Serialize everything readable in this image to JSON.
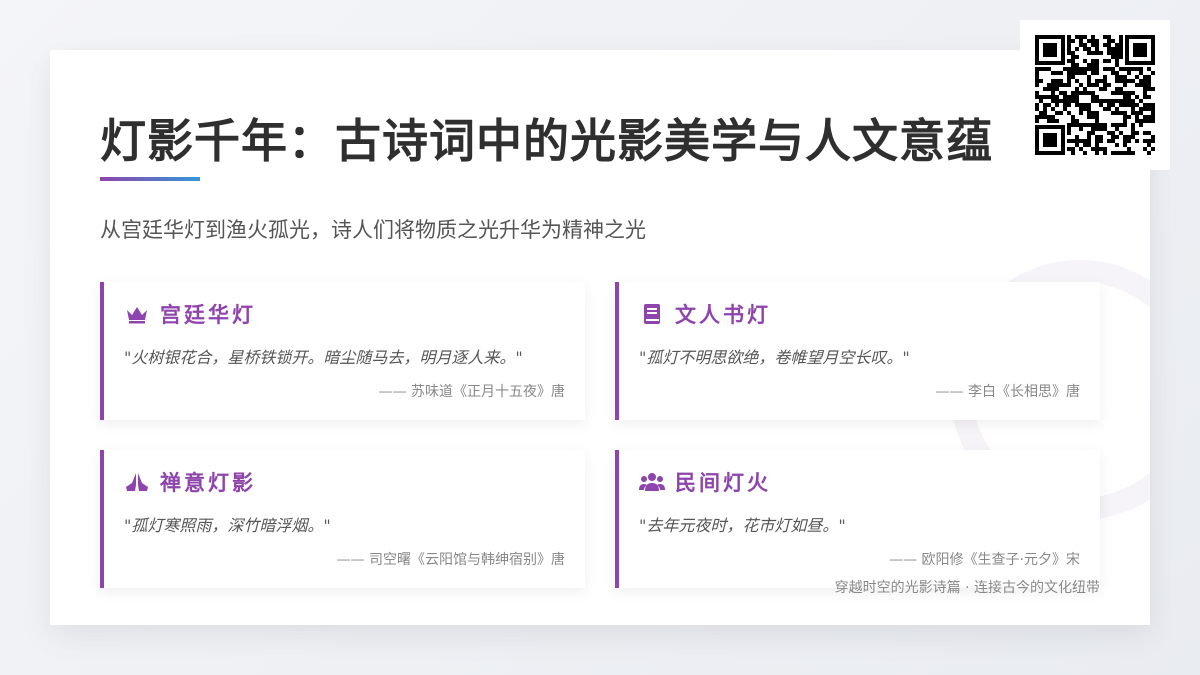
{
  "title": "灯影千年：古诗词中的光影美学与人文意蕴",
  "subtitle": "从宫廷华灯到渔火孤光，诗人们将物质之光升华为精神之光",
  "cards": [
    {
      "icon": "crown-icon",
      "title": "宫廷华灯",
      "quote": "\"火树银花合，星桥铁锁开。暗尘随马去，明月逐人来。\"",
      "source": "—— 苏味道《正月十五夜》唐"
    },
    {
      "icon": "book-icon",
      "title": "文人书灯",
      "quote": "\"孤灯不明思欲绝，卷帷望月空长叹。\"",
      "source": "—— 李白《长相思》唐"
    },
    {
      "icon": "praying-hands-icon",
      "title": "禅意灯影",
      "quote": "\"孤灯寒照雨，深竹暗浮烟。\"",
      "source": "—— 司空曙《云阳馆与韩绅宿别》唐"
    },
    {
      "icon": "users-icon",
      "title": "民间灯火",
      "quote": "\"去年元夜时，花市灯如昼。\"",
      "source": "—— 欧阳修《生查子·元夕》宋"
    }
  ],
  "footer_note": "穿越时空的光影诗篇 · 连接古今的文化纽带",
  "colors": {
    "accent": "#8e44ad",
    "accent_blue": "#3498db",
    "title": "#2f2f2f"
  }
}
